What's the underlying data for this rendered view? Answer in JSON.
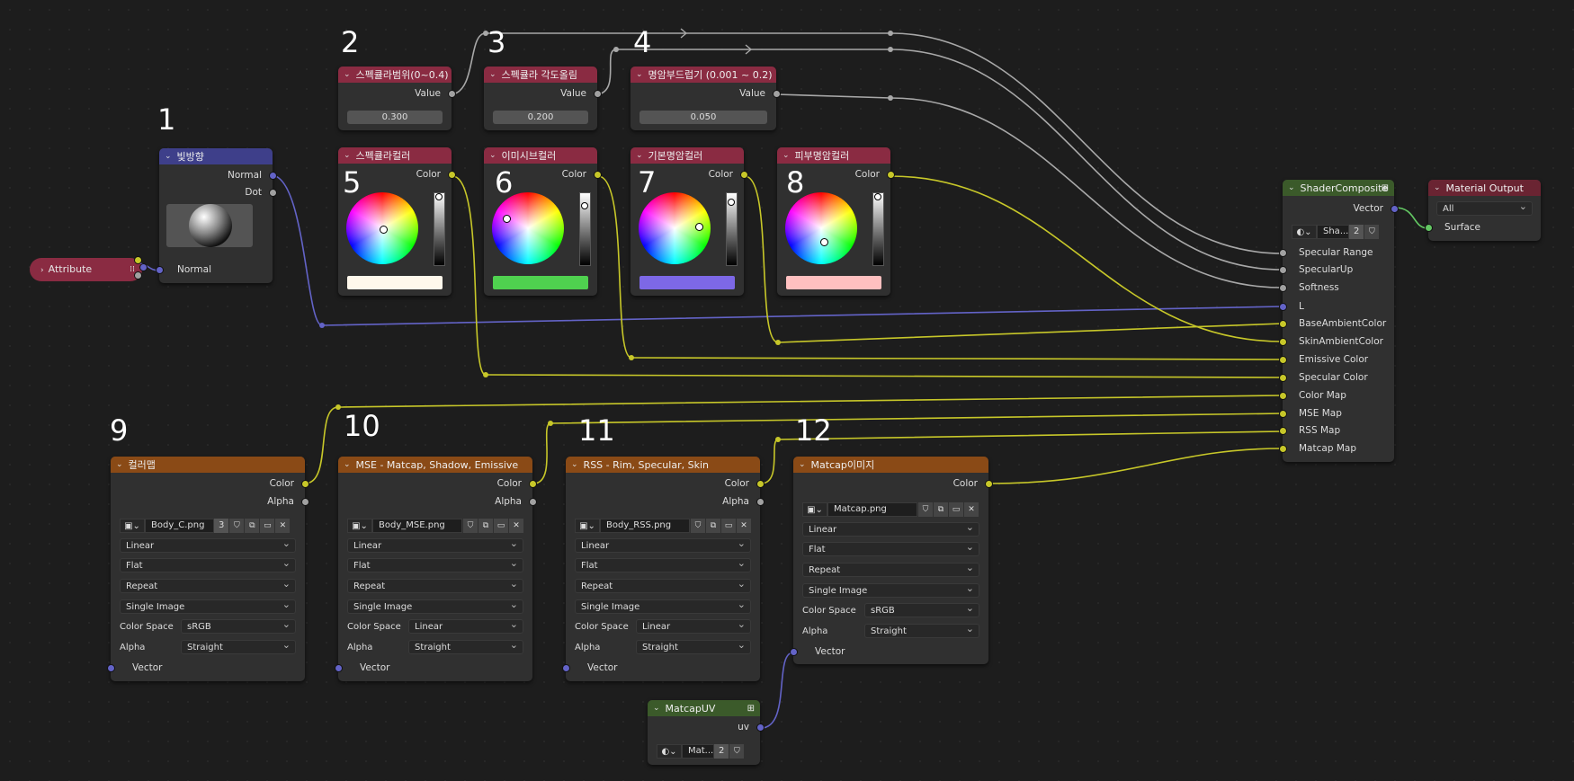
{
  "nodes": {
    "attribute": {
      "title": "Attribute"
    },
    "light_dir": {
      "number": "1",
      "title": "빛방향",
      "out_normal": "Normal",
      "out_dot": "Dot",
      "in_normal": "Normal"
    },
    "spec_range": {
      "number": "2",
      "title": "스펙큘라범위(0~0.4)",
      "out": "Value",
      "value": "0.300"
    },
    "spec_up": {
      "number": "3",
      "title": "스펙큘라 각도올림",
      "out": "Value",
      "value": "0.200"
    },
    "softness": {
      "number": "4",
      "title": "명암부드럽기 (0.001 ~ 0.2)",
      "out": "Value",
      "value": "0.050"
    },
    "spec_color": {
      "number": "5",
      "title": "스펙큘라컬러",
      "out": "Color",
      "swatch": "#fff8ec"
    },
    "emissive_color": {
      "number": "6",
      "title": "이미시브컬러",
      "out": "Color",
      "swatch": "#4fd14f"
    },
    "base_ambient": {
      "number": "7",
      "title": "기본명암컬러",
      "out": "Color",
      "swatch": "#7d68e6"
    },
    "skin_ambient": {
      "number": "8",
      "title": "피부명암컬러",
      "out": "Color",
      "swatch": "#ffc0c0"
    },
    "color_map": {
      "number": "9",
      "title": "컬러맵",
      "image": "Body_C.png",
      "users": "3",
      "interp": "Linear",
      "proj": "Flat",
      "ext": "Repeat",
      "source": "Single Image",
      "cs_label": "Color Space",
      "cs": "sRGB",
      "alpha_label": "Alpha",
      "alpha": "Straight",
      "out_color": "Color",
      "out_alpha": "Alpha",
      "in_vector": "Vector"
    },
    "mse_map": {
      "number": "10",
      "title": "MSE - Matcap, Shadow, Emissive",
      "image": "Body_MSE.png",
      "interp": "Linear",
      "proj": "Flat",
      "ext": "Repeat",
      "source": "Single Image",
      "cs_label": "Color Space",
      "cs": "Linear",
      "alpha_label": "Alpha",
      "alpha": "Straight",
      "out_color": "Color",
      "out_alpha": "Alpha",
      "in_vector": "Vector"
    },
    "rss_map": {
      "number": "11",
      "title": "RSS - Rim, Specular, Skin",
      "image": "Body_RSS.png",
      "interp": "Linear",
      "proj": "Flat",
      "ext": "Repeat",
      "source": "Single Image",
      "cs_label": "Color Space",
      "cs": "Linear",
      "alpha_label": "Alpha",
      "alpha": "Straight",
      "out_color": "Color",
      "out_alpha": "Alpha",
      "in_vector": "Vector"
    },
    "matcap_img": {
      "number": "12",
      "title": "Matcap이미지",
      "image": "Matcap.png",
      "interp": "Linear",
      "proj": "Flat",
      "ext": "Repeat",
      "source": "Single Image",
      "cs_label": "Color Space",
      "cs": "sRGB",
      "alpha_label": "Alpha",
      "alpha": "Straight",
      "out_color": "Color",
      "in_vector": "Vector"
    },
    "matcap_uv": {
      "title": "MatcapUV",
      "out": "uv",
      "group": "Mat...",
      "users": "2"
    },
    "shader_composite": {
      "title": "ShaderComposite",
      "out": "Vector",
      "group": "Sha...",
      "users": "2",
      "inputs": [
        "Specular Range",
        "SpecularUp",
        "Softness",
        "L",
        "BaseAmbientColor",
        "SkinAmbientColor",
        "Emissive Color",
        "Specular Color",
        "Color Map",
        "MSE Map",
        "RSS Map",
        "Matcap Map"
      ]
    },
    "material_output": {
      "title": "Material Output",
      "target": "All",
      "in_surface": "Surface"
    }
  },
  "colors": {
    "value_header": "#8a2b42",
    "vector_header": "#3e3f8a",
    "texture_header": "#8a4a16",
    "group_header": "#3b5a2a",
    "output_header": "#6a2432",
    "wire_gray": "#a8a8a8",
    "wire_yellow": "#c7c729",
    "wire_blue": "#6363c7",
    "wire_green": "#63c763"
  }
}
